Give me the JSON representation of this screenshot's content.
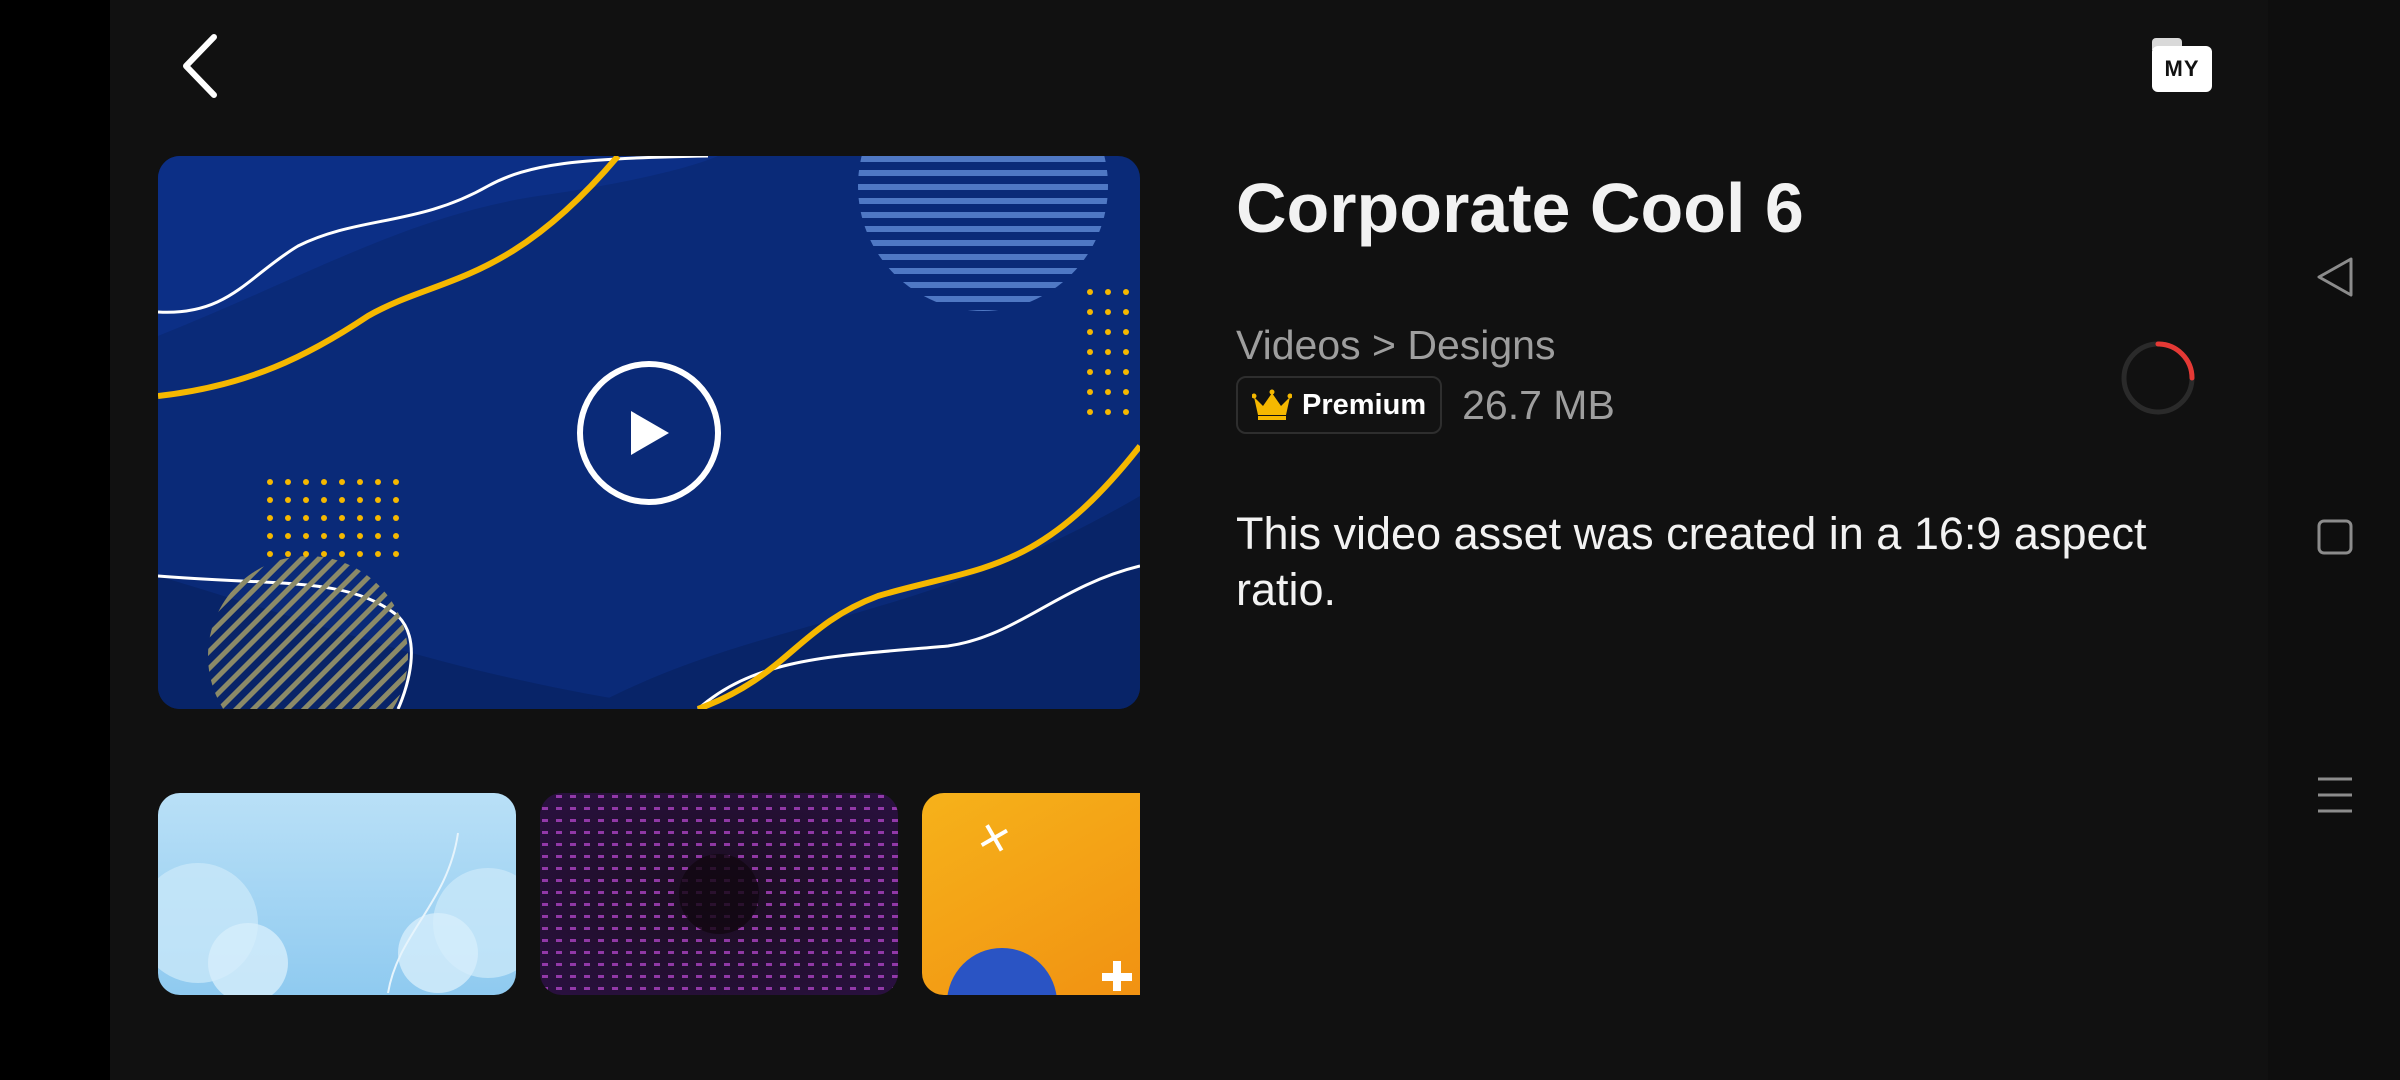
{
  "header": {
    "back_icon": "chevron-left-icon",
    "my_folder_label": "MY"
  },
  "asset": {
    "title": "Corporate Cool 6",
    "breadcrumb": "Videos > Designs",
    "badge_label": "Premium",
    "badge_icon": "crown-icon",
    "file_size": "26.7 MB",
    "description": "This video asset was created in a 16:9 aspect ratio."
  },
  "preview": {
    "play_icon": "play-icon"
  },
  "colors": {
    "background": "#111111",
    "preview_blue": "#0a2a78",
    "accent_yellow": "#f5b800",
    "spinner_red": "#e53935"
  },
  "thumbnails": [
    {
      "name": "light-blue-bubbles"
    },
    {
      "name": "purple-particles"
    },
    {
      "name": "orange-shapes"
    }
  ],
  "system_nav": {
    "back": "triangle-back-icon",
    "home": "square-home-icon",
    "menu": "menu-lines-icon"
  }
}
